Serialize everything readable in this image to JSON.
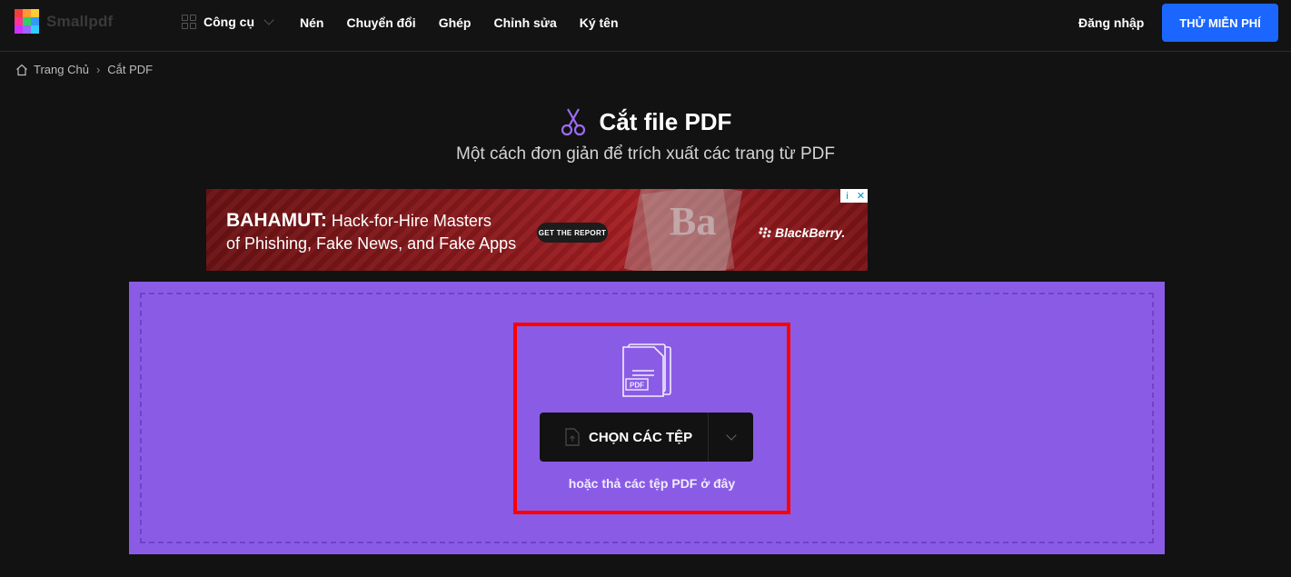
{
  "brand": {
    "name": "Smallpdf",
    "logo_colors": [
      "#f23d3d",
      "#ff9933",
      "#ffcc33",
      "#33cc66",
      "#3399ff",
      "#9966ff",
      "#ff3399",
      "#cc33ff",
      "#33ccff"
    ]
  },
  "nav": {
    "tools_label": "Công cụ",
    "links": [
      "Nén",
      "Chuyển đổi",
      "Ghép",
      "Chỉnh sửa",
      "Ký tên"
    ],
    "login": "Đăng nhập",
    "cta": "THỬ MIỄN PHÍ",
    "cta_color": "#1a66ff"
  },
  "breadcrumb": {
    "home": "Trang Chủ",
    "separator": "›",
    "current": "Cắt PDF"
  },
  "header": {
    "icon": "scissors-icon",
    "title": "Cắt file PDF",
    "subtitle": "Một cách đơn giản để trích xuất các trang từ PDF"
  },
  "ad": {
    "headline_bold": "BAHAMUT:",
    "headline_rest": " Hack-for-Hire Masters",
    "headline_line2": "of Phishing, Fake News, and Fake Apps",
    "button": "GET THE REPORT",
    "brand": "BlackBerry.",
    "info": "i",
    "close": "✕"
  },
  "dropzone": {
    "background": "#8a5ce6",
    "file_badge": "PDF",
    "choose_button": "CHỌN CÁC TỆP",
    "hint": "hoặc thả các tệp PDF ở đây"
  }
}
